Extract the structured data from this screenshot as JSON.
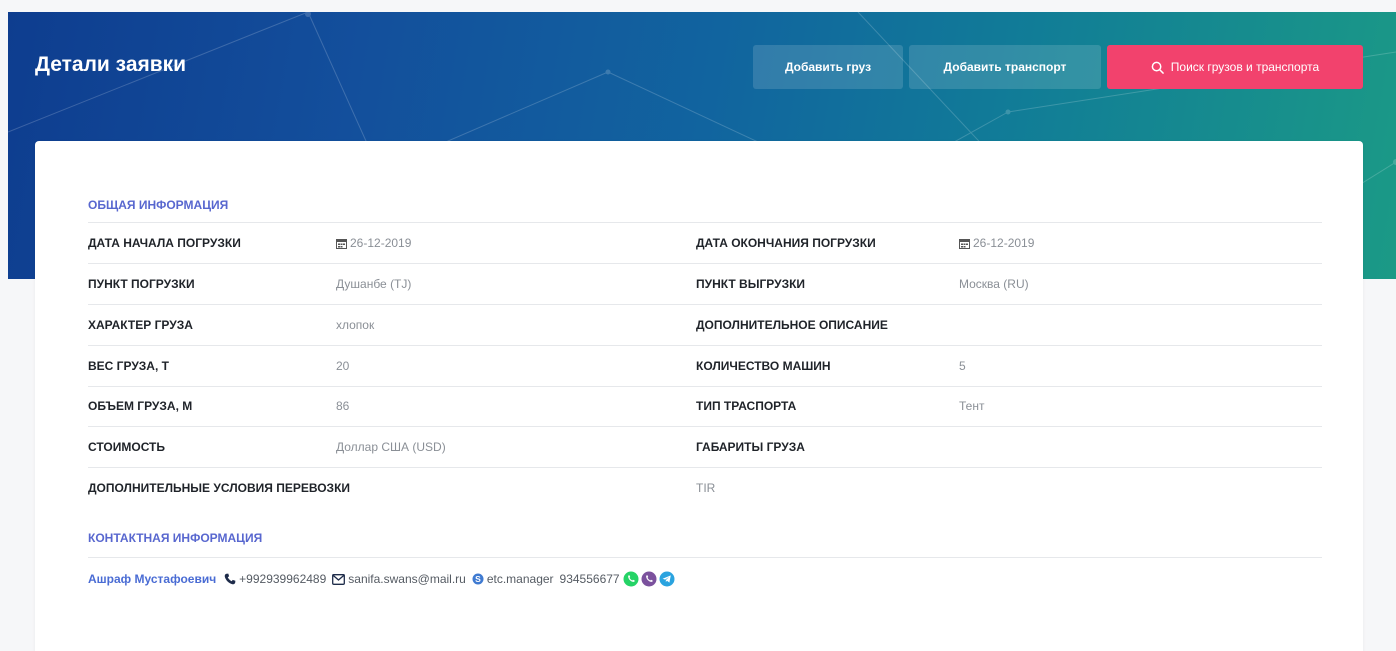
{
  "header": {
    "title": "Детали заявки",
    "add_cargo_label": "Добавить груз",
    "add_transport_label": "Добавить транспорт",
    "search_label": "Поиск грузов и транспорта"
  },
  "general": {
    "section_title": "ОБЩАЯ ИНФОРМАЦИЯ",
    "load_start_label": "ДАТА НАЧАЛА ПОГРУЗКИ",
    "load_start_value": "26-12-2019",
    "load_end_label": "ДАТА ОКОНЧАНИЯ ПОГРУЗКИ",
    "load_end_value": "26-12-2019",
    "load_point_label": "ПУНКТ ПОГРУЗКИ",
    "load_point_value": "Душанбе (TJ)",
    "unload_point_label": "ПУНКТ ВЫГРУЗКИ",
    "unload_point_value": "Москва (RU)",
    "cargo_type_label": "ХАРАКТЕР ГРУЗА",
    "cargo_type_value": "хлопок",
    "extra_desc_label": "ДОПОЛНИТЕЛЬНОЕ ОПИСАНИЕ",
    "extra_desc_value": "",
    "weight_label": "ВЕС ГРУЗА, Т",
    "weight_value": "20",
    "trucks_label": "КОЛИЧЕСТВО МАШИН",
    "trucks_value": "5",
    "volume_label": "ОБЪЕМ ГРУЗА, М",
    "volume_value": "86",
    "transport_type_label": "ТИП ТРАСПОРТА",
    "transport_type_value": "Тент",
    "price_label": "СТОИМОСТЬ",
    "price_value": "Доллар США (USD)",
    "dimensions_label": "ГАБАРИТЫ ГРУЗА",
    "dimensions_value": "",
    "conditions_label": "ДОПОЛНИТЕЛЬНЫЕ УСЛОВИЯ ПЕРЕВОЗКИ",
    "conditions_value": "TIR"
  },
  "contact": {
    "section_title": "КОНТАКТНАЯ ИНФОРМАЦИЯ",
    "name": "Ашраф Мустафоевич",
    "phone": "+992939962489",
    "email": "sanifa.swans@mail.ru",
    "skype": "etc.manager",
    "messenger_number": "934556677",
    "messengers": [
      "whatsapp-icon",
      "viber-icon",
      "telegram-icon"
    ]
  },
  "colors": {
    "accent": "#5867cf",
    "search_button": "#f2426d",
    "whatsapp": "#25d366",
    "viber": "#7b519d",
    "telegram": "#2aa3df"
  }
}
